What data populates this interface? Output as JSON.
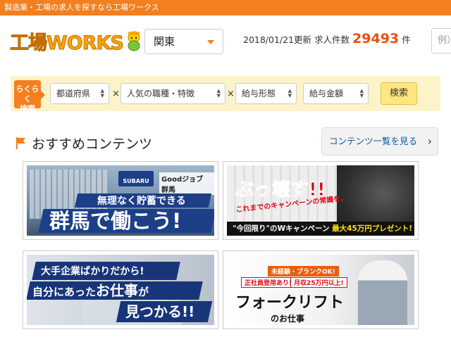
{
  "topbar": {
    "text": "製造業・工場の求人を探すなら工場ワークス"
  },
  "header": {
    "logo_text": "工場WORKS",
    "region_value": "関東",
    "updated": "2018/01/21更新",
    "job_count_label": "求人件数",
    "job_count": "29493",
    "job_count_unit": "件",
    "search_placeholder": "例）"
  },
  "search": {
    "easy_label_line1": "らくらく",
    "easy_label_line2": "検索",
    "selects": [
      "都道府県",
      "人気の職種・特徴",
      "給与形態",
      "給与金額"
    ],
    "times": "×",
    "button": "検索"
  },
  "section": {
    "title": "おすすめコンテンツ",
    "more_button": "コンテンツ一覧を見る"
  },
  "cards": [
    {
      "brand": "SUBARU",
      "tag": "Goodジョブ 群馬",
      "line1": "無理なく貯蓄できる",
      "line2": "群馬で働こう!"
    },
    {
      "line1": "ぶっ壊す!!",
      "line2": "これまでのキャンペーンの常識を。",
      "bar_a": "\"今回限り\"のWキャンペーン",
      "bar_b": "最大45万円プレゼント!"
    },
    {
      "line1": "大手企業ばかりだから!",
      "line2_a": "自分にあった",
      "line2_b": "お仕事",
      "line2_c": "が",
      "line3": "見つかる!!"
    },
    {
      "tag1": "未経験・ブランクOK!",
      "tag2": "正社員登用あり!",
      "tag3": "月収25万円以上!",
      "line1": "フォークリフト",
      "line2": "のお仕事"
    }
  ],
  "colors": {
    "accent": "#f47f1f",
    "count": "#e8500d",
    "link": "#0a5aa8"
  }
}
